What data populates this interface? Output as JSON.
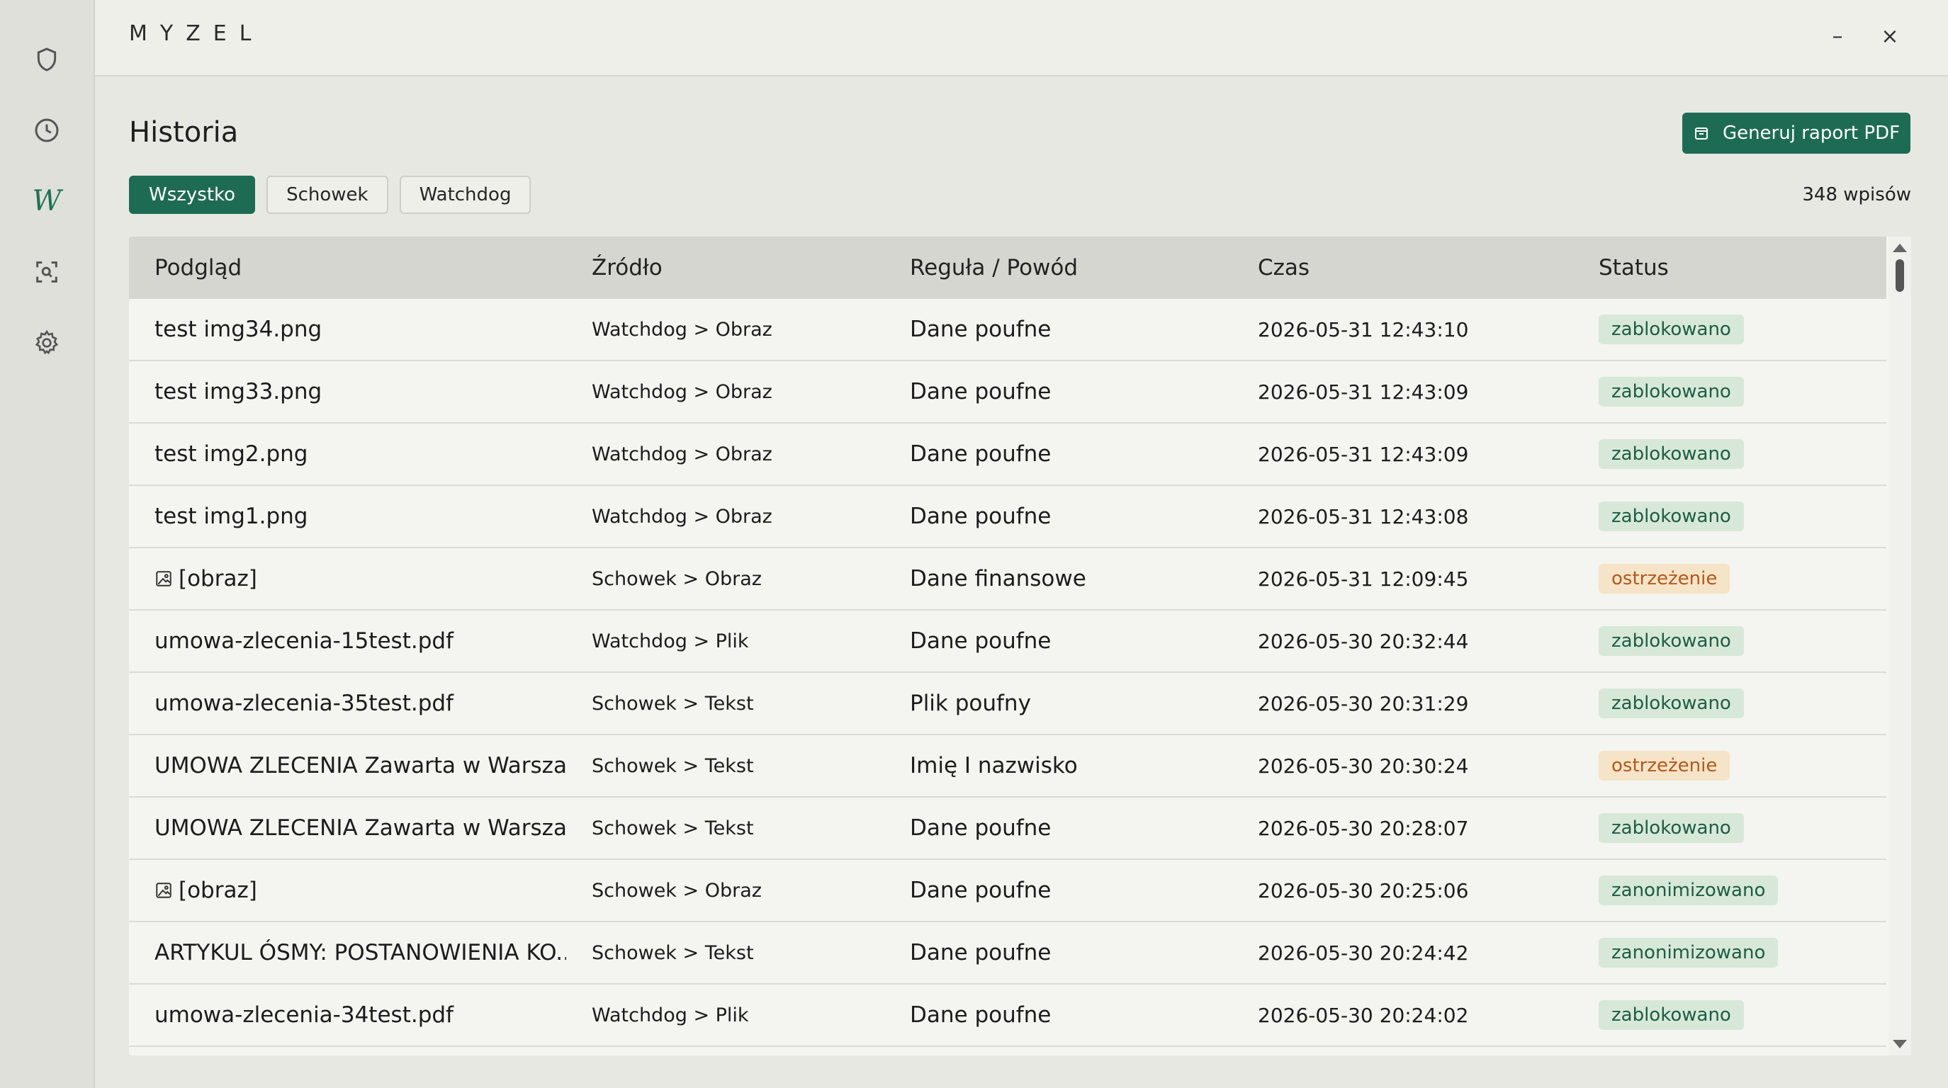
{
  "app": {
    "logo": "MYZEL",
    "minimize": "–",
    "close": "×"
  },
  "sidebar": {
    "items": [
      {
        "name": "shield-icon",
        "label": ""
      },
      {
        "name": "clock-icon",
        "label": ""
      },
      {
        "name": "brand-w-icon",
        "label": "W"
      },
      {
        "name": "scan-icon",
        "label": ""
      },
      {
        "name": "gear-icon",
        "label": ""
      }
    ],
    "accent": "#1e7256"
  },
  "page": {
    "title": "Historia",
    "pdf_button": "Generuj raport PDF",
    "count": "348 wpisów"
  },
  "tabs": [
    {
      "label": "Wszystko",
      "active": true
    },
    {
      "label": "Schowek",
      "active": false
    },
    {
      "label": "Watchdog",
      "active": false
    }
  ],
  "table": {
    "columns": [
      "Podgląd",
      "Źródło",
      "Reguła / Powód",
      "Czas",
      "Status"
    ],
    "rows": [
      {
        "preview": "test img34.png",
        "image": false,
        "source": "Watchdog > Obraz",
        "rule": "Dane poufne",
        "time": "2026-05-31 12:43:10",
        "status": "zablokowano",
        "kind": "blocked"
      },
      {
        "preview": "test img33.png",
        "image": false,
        "source": "Watchdog > Obraz",
        "rule": "Dane poufne",
        "time": "2026-05-31 12:43:09",
        "status": "zablokowano",
        "kind": "blocked"
      },
      {
        "preview": "test img2.png",
        "image": false,
        "source": "Watchdog > Obraz",
        "rule": "Dane poufne",
        "time": "2026-05-31 12:43:09",
        "status": "zablokowano",
        "kind": "blocked"
      },
      {
        "preview": "test img1.png",
        "image": false,
        "source": "Watchdog > Obraz",
        "rule": "Dane poufne",
        "time": "2026-05-31 12:43:08",
        "status": "zablokowano",
        "kind": "blocked"
      },
      {
        "preview": "[obraz]",
        "image": true,
        "source": "Schowek > Obraz",
        "rule": "Dane finansowe",
        "time": "2026-05-31 12:09:45",
        "status": "ostrzeżenie",
        "kind": "warn"
      },
      {
        "preview": "umowa-zlecenia-15test.pdf",
        "image": false,
        "source": "Watchdog > Plik",
        "rule": "Dane poufne",
        "time": "2026-05-30 20:32:44",
        "status": "zablokowano",
        "kind": "blocked"
      },
      {
        "preview": "umowa-zlecenia-35test.pdf",
        "image": false,
        "source": "Schowek > Tekst",
        "rule": "Plik poufny",
        "time": "2026-05-30 20:31:29",
        "status": "zablokowano",
        "kind": "blocked"
      },
      {
        "preview": "UMOWA ZLECENIA Zawarta w Warsza...",
        "image": false,
        "source": "Schowek > Tekst",
        "rule": "Imię I nazwisko",
        "time": "2026-05-30 20:30:24",
        "status": "ostrzeżenie",
        "kind": "warn"
      },
      {
        "preview": "UMOWA ZLECENIA Zawarta w Warsza...",
        "image": false,
        "source": "Schowek > Tekst",
        "rule": "Dane poufne",
        "time": "2026-05-30 20:28:07",
        "status": "zablokowano",
        "kind": "blocked"
      },
      {
        "preview": "[obraz]",
        "image": true,
        "source": "Schowek > Obraz",
        "rule": "Dane poufne",
        "time": "2026-05-30 20:25:06",
        "status": "zanonimizowano",
        "kind": "anon"
      },
      {
        "preview": "ARTYKUL ÓSMY: POSTANOWIENIA KO...",
        "image": false,
        "source": "Schowek > Tekst",
        "rule": "Dane poufne",
        "time": "2026-05-30 20:24:42",
        "status": "zanonimizowano",
        "kind": "anon"
      },
      {
        "preview": "umowa-zlecenia-34test.pdf",
        "image": false,
        "source": "Watchdog > Plik",
        "rule": "Dane poufne",
        "time": "2026-05-30 20:24:02",
        "status": "zablokowano",
        "kind": "blocked"
      }
    ]
  },
  "colors": {
    "primary": "#1e6b54",
    "blocked_bg": "#d7e8d9",
    "warn_bg": "#f6e4c8",
    "warn_text": "#b4581c"
  }
}
